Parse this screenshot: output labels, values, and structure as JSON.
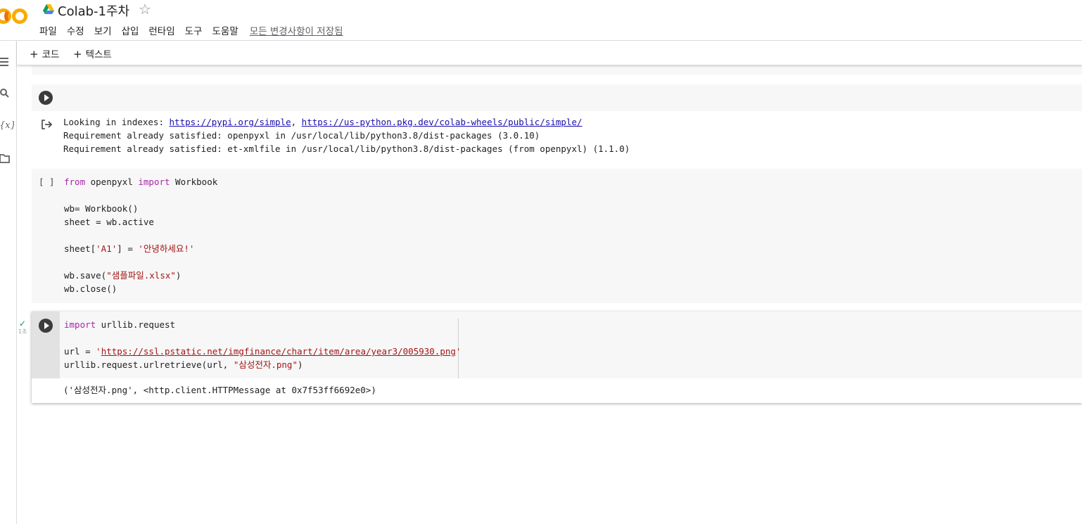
{
  "header": {
    "logo_text": "CO",
    "doc_title": "Colab-1주차",
    "star_glyph": "☆",
    "menu": [
      "파일",
      "수정",
      "보기",
      "삽입",
      "런타임",
      "도구",
      "도움말"
    ],
    "save_status": "모든 변경사항이 저장됨"
  },
  "toolbar": {
    "add_code_label": "코드",
    "add_text_label": "텍스트"
  },
  "cells": {
    "cell1": {
      "output": {
        "line1_prefix": "Looking in indexes: ",
        "link1": "https://pypi.org/simple",
        "separator": ", ",
        "link2": "https://us-python.pkg.dev/colab-wheels/public/simple/",
        "line2": "Requirement already satisfied: openpyxl in /usr/local/lib/python3.8/dist-packages (3.0.10)",
        "line3": "Requirement already satisfied: et-xmlfile in /usr/local/lib/python3.8/dist-packages (from openpyxl) (1.1.0)"
      }
    },
    "cell2": {
      "exec_count": "[ ]",
      "l1_kw1": "from",
      "l1_mod": " openpyxl ",
      "l1_kw2": "import",
      "l1_rest": " Workbook",
      "l2": "wb= Workbook()",
      "l3": "sheet = wb.active",
      "l4_a": "sheet[",
      "l4_str1": "'A1'",
      "l4_b": "] = ",
      "l4_str2": "'안녕하세요!'",
      "l5_a": "wb.save(",
      "l5_str": "\"샘플파일.xlsx\"",
      "l5_b": ")",
      "l6": "wb.close()"
    },
    "cell3": {
      "status_check": "✓",
      "exec_time": "1초",
      "l1_kw": "import",
      "l1_rest": " urllib.request",
      "l2_a": "url = ",
      "l2_q1": "'",
      "l2_url": "https://ssl.pstatic.net/imgfinance/chart/item/area/year3/005930.png",
      "l2_q2": "'",
      "l3_a": "urllib.request.urlretrieve(url, ",
      "l3_str": "\"삼성전자.png\"",
      "l3_b": ")",
      "output": "('삼성전자.png', <http.client.HTTPMessage at 0x7f53ff6692e0>)"
    }
  },
  "colors": {
    "keyword": "#a626a4",
    "string": "#a31515",
    "link": "#1a0dab",
    "logo_orange": "#f9ab00",
    "success_green": "#0f9d58"
  }
}
